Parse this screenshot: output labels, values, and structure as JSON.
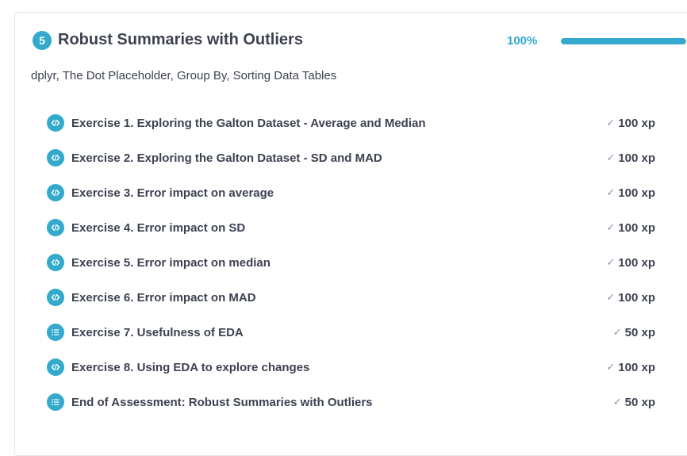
{
  "chapter": {
    "number": "5",
    "title": "Robust Summaries with Outliers",
    "progress_label": "100%",
    "progress": 1.0,
    "subtitle": "dplyr, The Dot Placeholder, Group By, Sorting Data Tables"
  },
  "exercises": [
    {
      "title": "Exercise 1. Exploring the Galton Dataset - Average and Median",
      "xp": "100 xp",
      "icon": "code-icon"
    },
    {
      "title": "Exercise 2. Exploring the Galton Dataset - SD and MAD",
      "xp": "100 xp",
      "icon": "code-icon"
    },
    {
      "title": "Exercise 3. Error impact on average",
      "xp": "100 xp",
      "icon": "code-icon"
    },
    {
      "title": "Exercise 4. Error impact on SD",
      "xp": "100 xp",
      "icon": "code-icon"
    },
    {
      "title": "Exercise 5. Error impact on median",
      "xp": "100 xp",
      "icon": "code-icon"
    },
    {
      "title": "Exercise 6. Error impact on MAD",
      "xp": "100 xp",
      "icon": "code-icon"
    },
    {
      "title": "Exercise 7. Usefulness of EDA",
      "xp": "50 xp",
      "icon": "list-icon"
    },
    {
      "title": "Exercise 8. Using EDA to explore changes",
      "xp": "100 xp",
      "icon": "code-icon"
    },
    {
      "title": "End of Assessment: Robust Summaries with Outliers",
      "xp": "50 xp",
      "icon": "list-icon"
    }
  ],
  "colors": {
    "accent": "#33aacc",
    "text": "#3d4251",
    "check": "#8c93a3"
  }
}
